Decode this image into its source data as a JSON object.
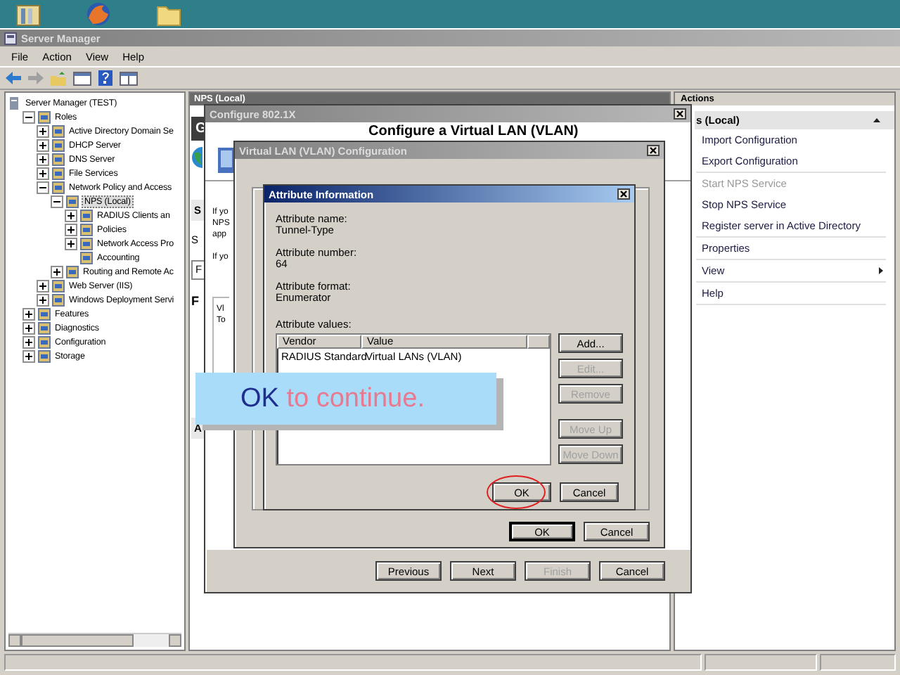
{
  "window": {
    "title": "Server Manager"
  },
  "menu": [
    "File",
    "Action",
    "View",
    "Help"
  ],
  "tree": [
    {
      "label": "Server Manager (TEST)",
      "selected": false,
      "children": [
        {
          "label": "Roles",
          "expanded": true,
          "selected": false,
          "children": [
            {
              "label": "Active Directory Domain Se",
              "expanded": false,
              "selected": false
            },
            {
              "label": "DHCP Server",
              "expanded": false,
              "selected": false
            },
            {
              "label": "DNS Server",
              "expanded": false,
              "selected": false
            },
            {
              "label": "File Services",
              "expanded": false,
              "selected": false
            },
            {
              "label": "Network Policy and Access",
              "expanded": true,
              "selected": false,
              "children": [
                {
                  "label": "NPS (Local)",
                  "expanded": true,
                  "selected": true,
                  "children": [
                    {
                      "label": "RADIUS Clients an",
                      "expanded": false,
                      "selected": false
                    },
                    {
                      "label": "Policies",
                      "expanded": false,
                      "selected": false
                    },
                    {
                      "label": "Network Access Pro",
                      "expanded": false,
                      "selected": false
                    },
                    {
                      "label": "Accounting",
                      "selected": false
                    }
                  ]
                },
                {
                  "label": "Routing and Remote Ac",
                  "expanded": false,
                  "selected": false
                }
              ]
            },
            {
              "label": "Web Server (IIS)",
              "expanded": false,
              "selected": false
            },
            {
              "label": "Windows Deployment Servi",
              "expanded": false,
              "selected": false
            }
          ]
        },
        {
          "label": "Features",
          "expanded": false,
          "selected": false
        },
        {
          "label": "Diagnostics",
          "expanded": false,
          "selected": false
        },
        {
          "label": "Configuration",
          "expanded": false,
          "selected": false
        },
        {
          "label": "Storage",
          "expanded": false,
          "selected": false
        }
      ]
    }
  ],
  "center": {
    "header": "NPS (Local)",
    "fragments": [
      {
        "kind": "banner",
        "text": "G"
      },
      {
        "kind": "section",
        "text": "S"
      },
      {
        "kind": "text",
        "text": "S"
      },
      {
        "kind": "box",
        "text": "F"
      },
      {
        "kind": "bold",
        "text": "F"
      },
      {
        "kind": "section",
        "text": "A"
      }
    ]
  },
  "wizard": {
    "title": "Configure 802.1X",
    "heading": "Configure a Virtual LAN (VLAN)",
    "fragments": [
      "If yo",
      "NPS",
      "app",
      "If yo"
    ],
    "group_fragments": [
      "Vl",
      "To"
    ],
    "buttons": [
      {
        "label": "Previous",
        "disabled": false
      },
      {
        "label": "Next",
        "disabled": false
      },
      {
        "label": "Finish",
        "disabled": true
      },
      {
        "label": "Cancel",
        "disabled": false
      }
    ]
  },
  "vlan_dialog": {
    "title": "Virtual LAN (VLAN) Configuration",
    "buttons": [
      {
        "label": "OK",
        "default": true
      },
      {
        "label": "Cancel",
        "default": false
      }
    ]
  },
  "attribute_dialog": {
    "title": "Attribute Information",
    "fields": [
      {
        "label": "Attribute name:",
        "value": "Tunnel-Type"
      },
      {
        "label": "Attribute number:",
        "value": "64"
      },
      {
        "label": "Attribute format:",
        "value": "Enumerator"
      }
    ],
    "values_label": "Attribute values:",
    "columns": [
      "Vendor",
      "Value"
    ],
    "rows": [
      [
        "RADIUS Standard",
        "Virtual LANs (VLAN)"
      ]
    ],
    "side_buttons": [
      {
        "label": "Add...",
        "disabled": false
      },
      {
        "label": "Edit...",
        "disabled": true
      },
      {
        "label": "Remove",
        "disabled": true
      },
      {
        "label": "Move Up",
        "disabled": true
      },
      {
        "label": "Move Down",
        "disabled": true
      }
    ],
    "buttons": [
      {
        "label": "OK",
        "circled": true
      },
      {
        "label": "Cancel",
        "circled": false
      }
    ]
  },
  "callout": {
    "parts": [
      {
        "kind": "keyword",
        "text": "OK"
      },
      {
        "kind": "plain",
        "text": "to continue."
      }
    ]
  },
  "actions": {
    "title": "Actions",
    "section": "s (Local)",
    "groups": [
      [
        {
          "label": "Import Configuration",
          "kind": "item",
          "disabled": false
        },
        {
          "label": "Export Configuration",
          "kind": "item",
          "disabled": false
        }
      ],
      [
        {
          "label": "Start NPS Service",
          "kind": "item",
          "disabled": true
        },
        {
          "label": "Stop NPS Service",
          "kind": "item",
          "disabled": false
        },
        {
          "label": "Register server in Active Directory",
          "kind": "item",
          "disabled": false
        }
      ],
      [
        {
          "label": "Properties",
          "kind": "item",
          "disabled": false
        }
      ],
      [
        {
          "label": "View",
          "kind": "submenu",
          "disabled": false
        }
      ],
      [
        {
          "label": "Help",
          "kind": "item",
          "disabled": false
        }
      ]
    ]
  }
}
